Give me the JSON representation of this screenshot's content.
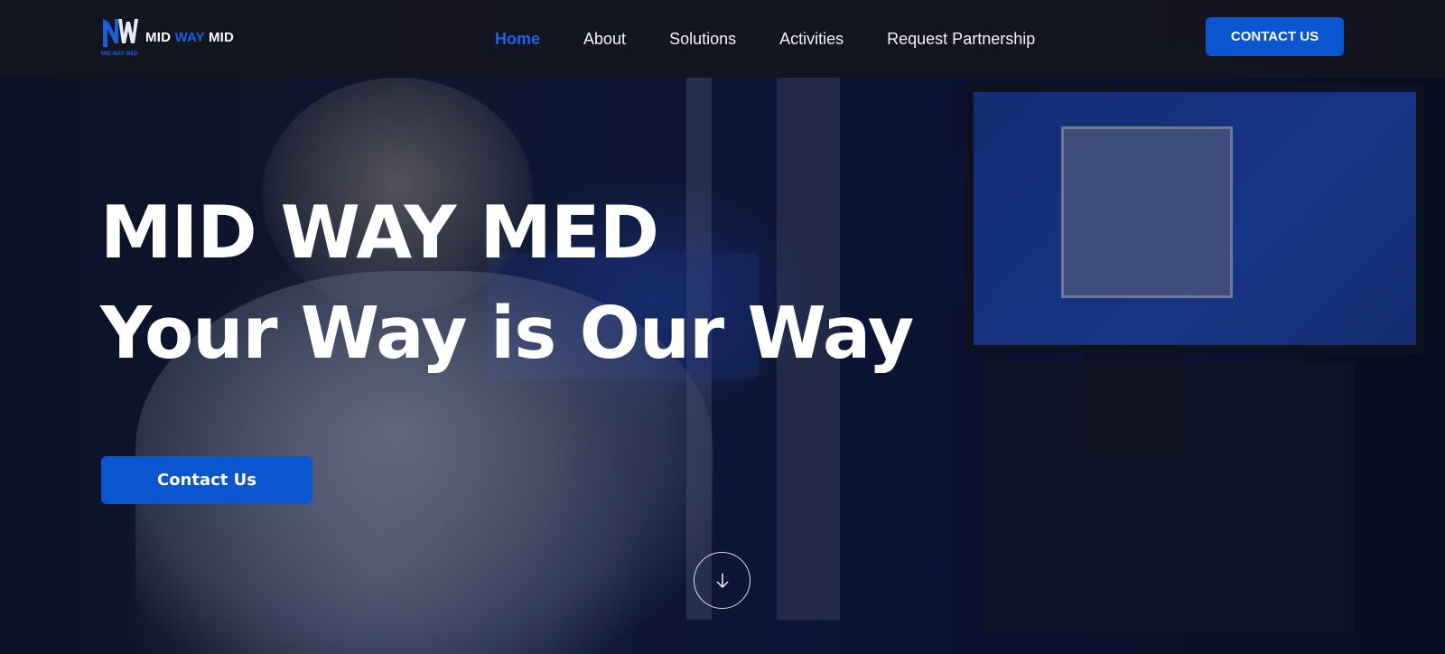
{
  "header": {
    "logo": {
      "text_part_1": "MID",
      "text_part_2": "WAY",
      "text_part_3": "MID",
      "mark_caption": "MID WAY MED",
      "icon": "mw-logo-icon"
    },
    "nav": [
      {
        "label": "Home",
        "active": true
      },
      {
        "label": "About",
        "active": false
      },
      {
        "label": "Solutions",
        "active": false
      },
      {
        "label": "Activities",
        "active": false
      },
      {
        "label": "Request Partnership",
        "active": false
      }
    ],
    "cta_label": "CONTACT US"
  },
  "hero": {
    "title": "MID WAY MED",
    "subtitle": "Your Way is Our Way",
    "cta_label": "Contact Us",
    "scroll_icon": "arrow-down-icon"
  },
  "colors": {
    "accent": "#0a55d0",
    "nav_active": "#1f63e6",
    "header_bg": "#14161e",
    "text": "#ffffff"
  }
}
